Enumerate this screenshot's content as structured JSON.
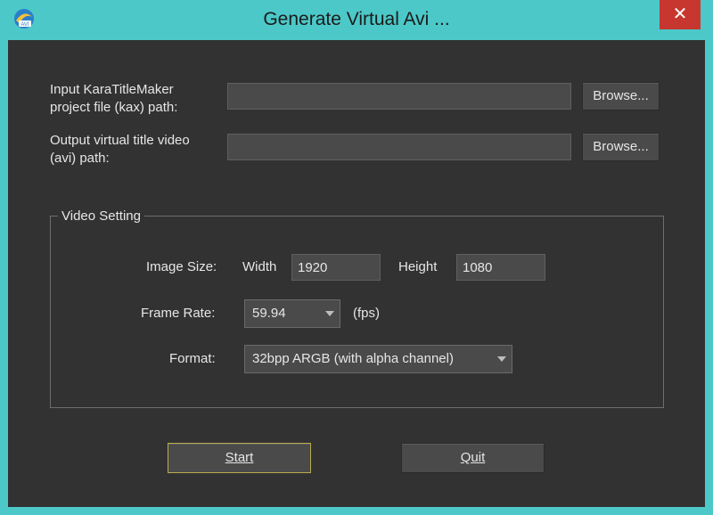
{
  "window": {
    "title": "Generate Virtual Avi ...",
    "close_glyph": "✕",
    "icon": "avi-app-icon"
  },
  "input_project": {
    "label_line1": "Input KaraTitleMaker",
    "label_line2": "project file (kax) path:",
    "value": "",
    "browse_label": "Browse..."
  },
  "output_video": {
    "label_line1": "Output virtual title video",
    "label_line2": "(avi) path:",
    "value": "",
    "browse_label": "Browse..."
  },
  "video_setting": {
    "group_title": "Video Setting",
    "image_size_label": "Image Size:",
    "width_label": "Width",
    "width_value": "1920",
    "height_label": "Height",
    "height_value": "1080",
    "frame_rate_label": "Frame Rate:",
    "frame_rate_value": "59.94",
    "fps_label": "(fps)",
    "format_label": "Format:",
    "format_value": "32bpp ARGB (with alpha channel)"
  },
  "buttons": {
    "start": "Start",
    "quit": "Quit"
  },
  "colors": {
    "frame": "#4cc8c8",
    "client_bg": "#323232",
    "close": "#c7372f",
    "default_button_border": "#b9ad52"
  }
}
